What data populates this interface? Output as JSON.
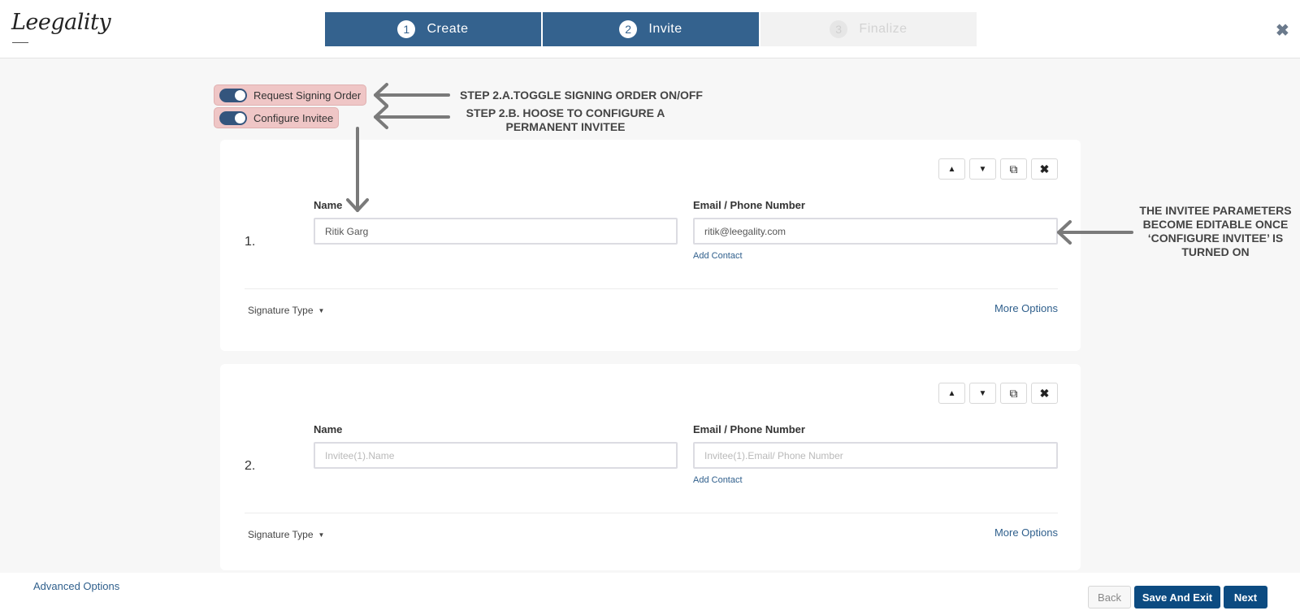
{
  "app": {
    "logo_text": "Leegality"
  },
  "header": {
    "steps": [
      {
        "num": "1",
        "label": "Create",
        "state": "active"
      },
      {
        "num": "2",
        "label": "Invite",
        "state": "active"
      },
      {
        "num": "3",
        "label": "Finalize",
        "state": "inactive"
      }
    ],
    "close_icon": "✖"
  },
  "toggles": {
    "signing_order": {
      "label": "Request Signing Order",
      "on": true
    },
    "configure_invitee": {
      "label": "Configure Invitee",
      "on": true
    }
  },
  "annotations": {
    "step_2a": "STEP 2.A.TOGGLE SIGNING ORDER ON/OFF",
    "step_2b_line1": "STEP 2.B. HOOSE TO CONFIGURE A",
    "step_2b_line2": "PERMANENT INVITEE",
    "invitee_line1": "THE INVITEE PARAMETERS",
    "invitee_line2": "BECOME EDITABLE ONCE",
    "invitee_line3": "‘CONFIGURE INVITEE’ IS",
    "invitee_line4": "TURNED ON"
  },
  "invitees": [
    {
      "number": "1.",
      "name_label": "Name",
      "name_value": "Ritik Garg",
      "contact_label": "Email / Phone Number",
      "contact_value": "ritik@leegality.com",
      "add_contact": "Add Contact",
      "signature_type": "Signature Type",
      "more_options": "More Options"
    },
    {
      "number": "2.",
      "name_label": "Name",
      "name_placeholder": "Invitee(1).Name",
      "contact_label": "Email / Phone Number",
      "contact_placeholder": "Invitee(1).Email/ Phone Number",
      "add_contact": "Add Contact",
      "signature_type": "Signature Type",
      "more_options": "More Options"
    }
  ],
  "card_buttons": {
    "up": "▲",
    "down": "▼",
    "copy": "⧉",
    "remove": "✖"
  },
  "footer": {
    "advanced_options": "Advanced Options",
    "back": "Back",
    "save_exit": "Save And Exit",
    "next": "Next"
  },
  "colors": {
    "primary": "#34628e",
    "button": "#0c4b81",
    "highlight": "#efc6c6"
  }
}
